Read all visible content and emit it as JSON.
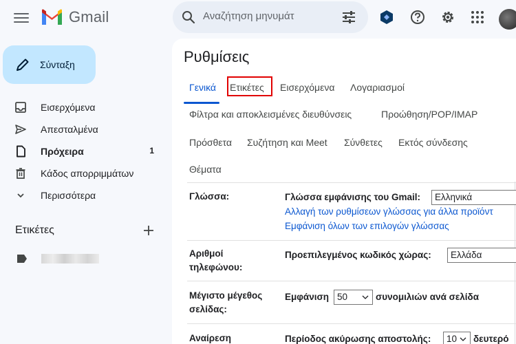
{
  "app": {
    "name": "Gmail"
  },
  "search": {
    "placeholder": "Αναζήτηση μηνυμάτ"
  },
  "compose": {
    "label": "Σύνταξη"
  },
  "nav": [
    {
      "label": "Εισερχόμενα",
      "count": "",
      "bold": false,
      "icon": "inbox-icon"
    },
    {
      "label": "Απεσταλμένα",
      "count": "",
      "bold": false,
      "icon": "send-icon"
    },
    {
      "label": "Πρόχειρα",
      "count": "1",
      "bold": true,
      "icon": "draft-icon"
    },
    {
      "label": "Κάδος απορριμμάτων",
      "count": "",
      "bold": false,
      "icon": "trash-icon"
    },
    {
      "label": "Περισσότερα",
      "count": "",
      "bold": false,
      "icon": "chevron-down-icon"
    }
  ],
  "labels": {
    "title": "Ετικέτες"
  },
  "settings": {
    "title": "Ρυθμίσεις",
    "tabs": [
      "Γενικά",
      "Ετικέτες",
      "Εισερχόμενα",
      "Λογαριασμοί",
      "Φίλτρα και αποκλεισμένες διευθύνσεις",
      "Προώθηση/POP/IMAP",
      "Πρόσθετα",
      "Συζήτηση και Meet",
      "Σύνθετες",
      "Εκτός σύνδεσης",
      "Θέματα"
    ],
    "active_tab": "Γενικά",
    "highlighted_tab": "Ετικέτες",
    "language": {
      "label": "Γλώσσα:",
      "display_label": "Γλώσσα εμφάνισης του Gmail:",
      "value": "Ελληνικά",
      "link1": "Αλλαγή των ρυθμίσεων γλώσσας για άλλα προϊόντ",
      "link2": "Εμφάνιση όλων των επιλογών γλώσσας"
    },
    "phone": {
      "label_line1": "Αριθμοί",
      "label_line2": "τηλεφώνου:",
      "text": "Προεπιλεγμένος κωδικός χώρας:",
      "value": "Ελλάδα"
    },
    "page_size": {
      "label_line1": "Μέγιστο μέγεθος",
      "label_line2": "σελίδας:",
      "prefix": "Εμφάνιση",
      "value": "50",
      "suffix": "συνομιλιών ανά σελίδα"
    },
    "undo": {
      "label_line1": "Αναίρεση",
      "text": "Περίοδος ακύρωσης αποστολής:",
      "value": "10",
      "suffix": "δευτερό"
    }
  },
  "colors": {
    "accent": "#0b57d0",
    "compose_bg": "#c2e7ff",
    "highlight": "#e10000"
  }
}
